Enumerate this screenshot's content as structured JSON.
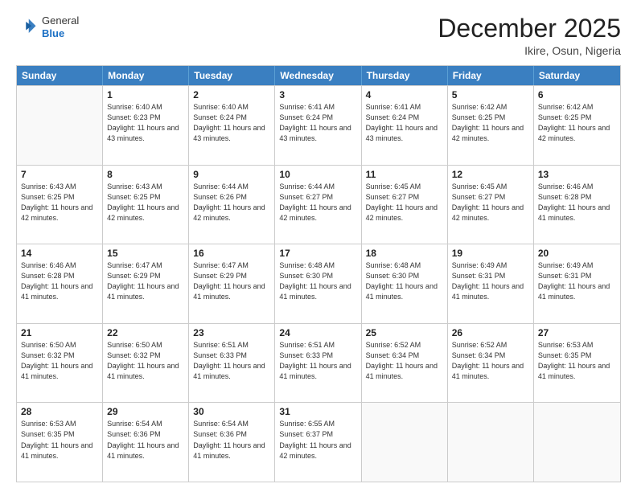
{
  "header": {
    "logo_line1": "General",
    "logo_line2": "Blue",
    "month": "December 2025",
    "location": "Ikire, Osun, Nigeria"
  },
  "weekdays": [
    "Sunday",
    "Monday",
    "Tuesday",
    "Wednesday",
    "Thursday",
    "Friday",
    "Saturday"
  ],
  "rows": [
    [
      {
        "day": "",
        "sunrise": "",
        "sunset": "",
        "daylight": ""
      },
      {
        "day": "1",
        "sunrise": "Sunrise: 6:40 AM",
        "sunset": "Sunset: 6:23 PM",
        "daylight": "Daylight: 11 hours and 43 minutes."
      },
      {
        "day": "2",
        "sunrise": "Sunrise: 6:40 AM",
        "sunset": "Sunset: 6:24 PM",
        "daylight": "Daylight: 11 hours and 43 minutes."
      },
      {
        "day": "3",
        "sunrise": "Sunrise: 6:41 AM",
        "sunset": "Sunset: 6:24 PM",
        "daylight": "Daylight: 11 hours and 43 minutes."
      },
      {
        "day": "4",
        "sunrise": "Sunrise: 6:41 AM",
        "sunset": "Sunset: 6:24 PM",
        "daylight": "Daylight: 11 hours and 43 minutes."
      },
      {
        "day": "5",
        "sunrise": "Sunrise: 6:42 AM",
        "sunset": "Sunset: 6:25 PM",
        "daylight": "Daylight: 11 hours and 42 minutes."
      },
      {
        "day": "6",
        "sunrise": "Sunrise: 6:42 AM",
        "sunset": "Sunset: 6:25 PM",
        "daylight": "Daylight: 11 hours and 42 minutes."
      }
    ],
    [
      {
        "day": "7",
        "sunrise": "Sunrise: 6:43 AM",
        "sunset": "Sunset: 6:25 PM",
        "daylight": "Daylight: 11 hours and 42 minutes."
      },
      {
        "day": "8",
        "sunrise": "Sunrise: 6:43 AM",
        "sunset": "Sunset: 6:25 PM",
        "daylight": "Daylight: 11 hours and 42 minutes."
      },
      {
        "day": "9",
        "sunrise": "Sunrise: 6:44 AM",
        "sunset": "Sunset: 6:26 PM",
        "daylight": "Daylight: 11 hours and 42 minutes."
      },
      {
        "day": "10",
        "sunrise": "Sunrise: 6:44 AM",
        "sunset": "Sunset: 6:27 PM",
        "daylight": "Daylight: 11 hours and 42 minutes."
      },
      {
        "day": "11",
        "sunrise": "Sunrise: 6:45 AM",
        "sunset": "Sunset: 6:27 PM",
        "daylight": "Daylight: 11 hours and 42 minutes."
      },
      {
        "day": "12",
        "sunrise": "Sunrise: 6:45 AM",
        "sunset": "Sunset: 6:27 PM",
        "daylight": "Daylight: 11 hours and 42 minutes."
      },
      {
        "day": "13",
        "sunrise": "Sunrise: 6:46 AM",
        "sunset": "Sunset: 6:28 PM",
        "daylight": "Daylight: 11 hours and 41 minutes."
      }
    ],
    [
      {
        "day": "14",
        "sunrise": "Sunrise: 6:46 AM",
        "sunset": "Sunset: 6:28 PM",
        "daylight": "Daylight: 11 hours and 41 minutes."
      },
      {
        "day": "15",
        "sunrise": "Sunrise: 6:47 AM",
        "sunset": "Sunset: 6:29 PM",
        "daylight": "Daylight: 11 hours and 41 minutes."
      },
      {
        "day": "16",
        "sunrise": "Sunrise: 6:47 AM",
        "sunset": "Sunset: 6:29 PM",
        "daylight": "Daylight: 11 hours and 41 minutes."
      },
      {
        "day": "17",
        "sunrise": "Sunrise: 6:48 AM",
        "sunset": "Sunset: 6:30 PM",
        "daylight": "Daylight: 11 hours and 41 minutes."
      },
      {
        "day": "18",
        "sunrise": "Sunrise: 6:48 AM",
        "sunset": "Sunset: 6:30 PM",
        "daylight": "Daylight: 11 hours and 41 minutes."
      },
      {
        "day": "19",
        "sunrise": "Sunrise: 6:49 AM",
        "sunset": "Sunset: 6:31 PM",
        "daylight": "Daylight: 11 hours and 41 minutes."
      },
      {
        "day": "20",
        "sunrise": "Sunrise: 6:49 AM",
        "sunset": "Sunset: 6:31 PM",
        "daylight": "Daylight: 11 hours and 41 minutes."
      }
    ],
    [
      {
        "day": "21",
        "sunrise": "Sunrise: 6:50 AM",
        "sunset": "Sunset: 6:32 PM",
        "daylight": "Daylight: 11 hours and 41 minutes."
      },
      {
        "day": "22",
        "sunrise": "Sunrise: 6:50 AM",
        "sunset": "Sunset: 6:32 PM",
        "daylight": "Daylight: 11 hours and 41 minutes."
      },
      {
        "day": "23",
        "sunrise": "Sunrise: 6:51 AM",
        "sunset": "Sunset: 6:33 PM",
        "daylight": "Daylight: 11 hours and 41 minutes."
      },
      {
        "day": "24",
        "sunrise": "Sunrise: 6:51 AM",
        "sunset": "Sunset: 6:33 PM",
        "daylight": "Daylight: 11 hours and 41 minutes."
      },
      {
        "day": "25",
        "sunrise": "Sunrise: 6:52 AM",
        "sunset": "Sunset: 6:34 PM",
        "daylight": "Daylight: 11 hours and 41 minutes."
      },
      {
        "day": "26",
        "sunrise": "Sunrise: 6:52 AM",
        "sunset": "Sunset: 6:34 PM",
        "daylight": "Daylight: 11 hours and 41 minutes."
      },
      {
        "day": "27",
        "sunrise": "Sunrise: 6:53 AM",
        "sunset": "Sunset: 6:35 PM",
        "daylight": "Daylight: 11 hours and 41 minutes."
      }
    ],
    [
      {
        "day": "28",
        "sunrise": "Sunrise: 6:53 AM",
        "sunset": "Sunset: 6:35 PM",
        "daylight": "Daylight: 11 hours and 41 minutes."
      },
      {
        "day": "29",
        "sunrise": "Sunrise: 6:54 AM",
        "sunset": "Sunset: 6:36 PM",
        "daylight": "Daylight: 11 hours and 41 minutes."
      },
      {
        "day": "30",
        "sunrise": "Sunrise: 6:54 AM",
        "sunset": "Sunset: 6:36 PM",
        "daylight": "Daylight: 11 hours and 41 minutes."
      },
      {
        "day": "31",
        "sunrise": "Sunrise: 6:55 AM",
        "sunset": "Sunset: 6:37 PM",
        "daylight": "Daylight: 11 hours and 42 minutes."
      },
      {
        "day": "",
        "sunrise": "",
        "sunset": "",
        "daylight": ""
      },
      {
        "day": "",
        "sunrise": "",
        "sunset": "",
        "daylight": ""
      },
      {
        "day": "",
        "sunrise": "",
        "sunset": "",
        "daylight": ""
      }
    ]
  ]
}
